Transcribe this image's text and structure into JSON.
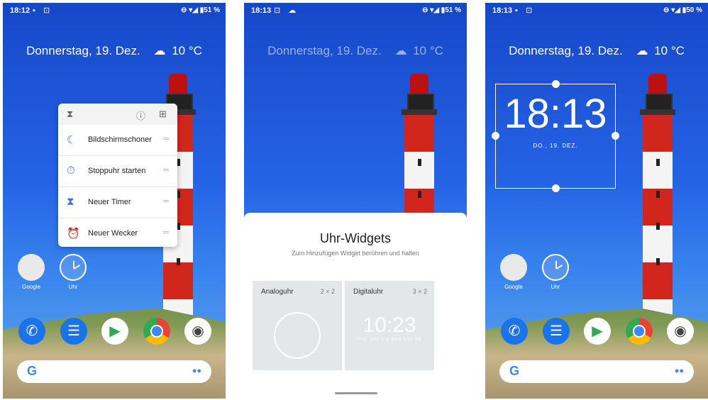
{
  "screens": [
    {
      "status": {
        "time": "18:12",
        "icons": "▪ ⊡",
        "right": "⊖ ▾◢ ▮51 %"
      },
      "date": "Donnerstag, 19. Dez.",
      "weather": "10 °C",
      "popup": {
        "items": [
          {
            "icon": "moon-icon",
            "label": "Bildschirmschoner"
          },
          {
            "icon": "stopwatch-icon",
            "label": "Stoppuhr starten"
          },
          {
            "icon": "hourglass-icon",
            "label": "Neuer Timer"
          },
          {
            "icon": "alarm-icon",
            "label": "Neuer Wecker"
          }
        ]
      },
      "home_icons": [
        {
          "label": "Google"
        },
        {
          "label": "Uhr"
        }
      ]
    },
    {
      "status": {
        "time": "18:13",
        "icons": "⊡ ☁",
        "right": "⊖ ▾◢ ▮51 %"
      },
      "date": "Donnerstag, 19. Dez.",
      "weather": "10 °C",
      "sheet": {
        "title": "Uhr-Widgets",
        "subtitle": "Zum Hinzufügen Widget berühren und halten",
        "widgets": [
          {
            "name": "Analoguhr",
            "size": "2 × 2"
          },
          {
            "name": "Digitaluhr",
            "size": "3 × 2",
            "preview_time": "10:23",
            "preview_sub": "THU, MAY 9 ⊙ MON 4:00 AM"
          }
        ]
      }
    },
    {
      "status": {
        "time": "18:13",
        "icons": "▪ ⊡",
        "right": "⊖ ▾◢ ▮50 %"
      },
      "date": "Donnerstag, 19. Dez.",
      "weather": "10 °C",
      "widget": {
        "time": "18:13",
        "date": "DO., 19. DEZ."
      },
      "home_icons": [
        {
          "label": "Google"
        },
        {
          "label": "Uhr"
        }
      ]
    }
  ],
  "dock_apps": [
    "phone",
    "messages",
    "play-store",
    "chrome",
    "camera"
  ],
  "colors": {
    "sky": "#1f55d6",
    "tower_red": "#d0261c",
    "accent": "#3b6fd8"
  }
}
